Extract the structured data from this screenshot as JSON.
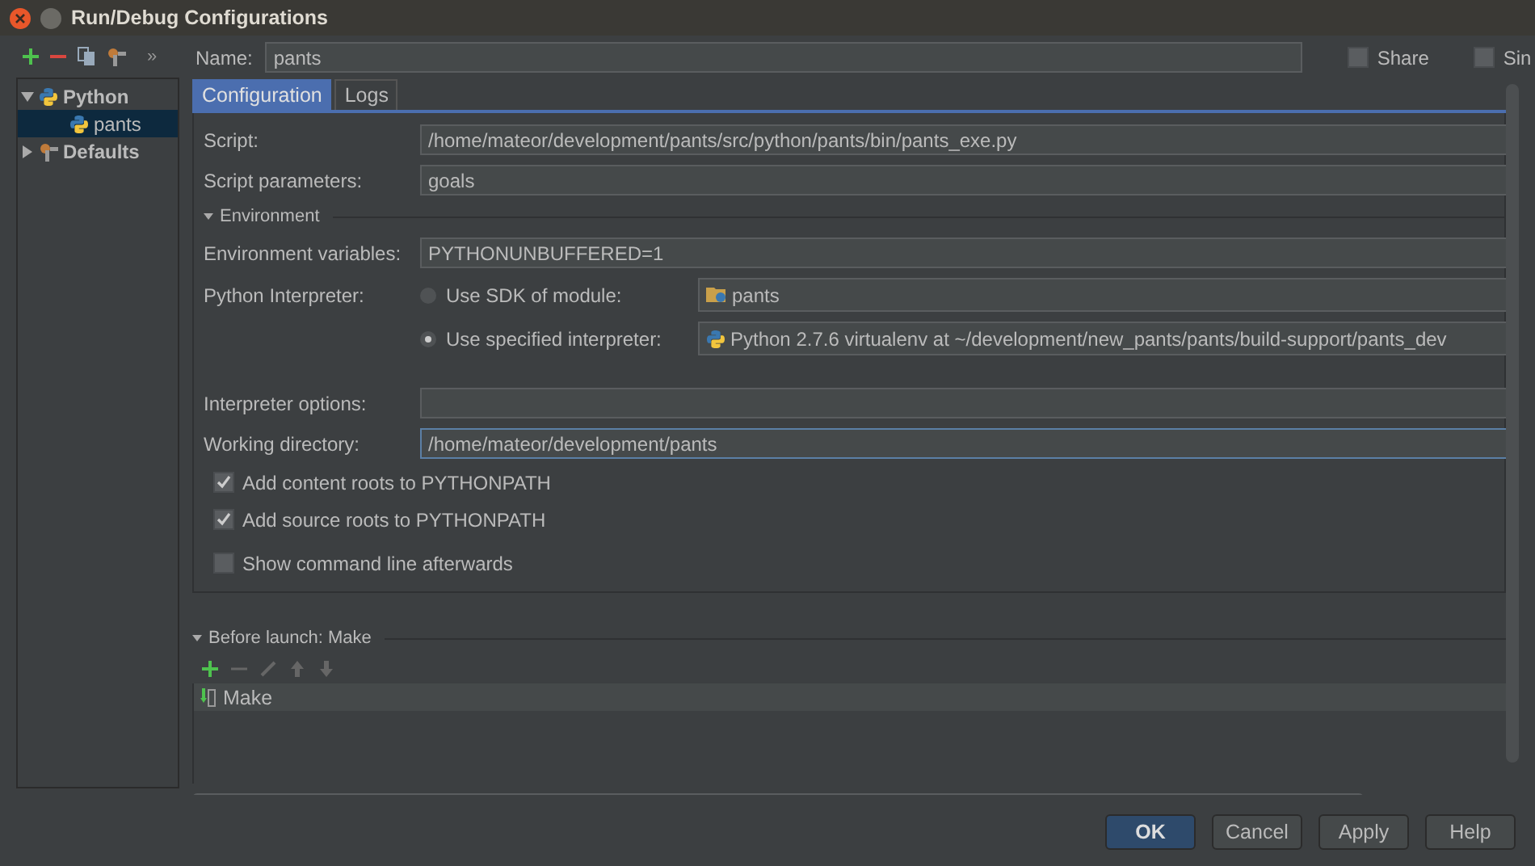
{
  "window": {
    "title": "Run/Debug Configurations"
  },
  "toolbar": {
    "more": "»"
  },
  "tree": [
    {
      "label": "Python",
      "kind": "python",
      "expanded": true,
      "selected": false,
      "children": [
        {
          "label": "pants",
          "kind": "python",
          "selected": true
        }
      ]
    },
    {
      "label": "Defaults",
      "kind": "defaults",
      "expanded": false,
      "selected": false
    }
  ],
  "name_field": {
    "label": "Name:",
    "value": "pants"
  },
  "header_checks": [
    {
      "label": "Share",
      "checked": false
    },
    {
      "label": "Sin",
      "checked": false
    }
  ],
  "tabs": [
    {
      "label": "Configuration",
      "selected": true
    },
    {
      "label": "Logs",
      "selected": false
    }
  ],
  "script": {
    "label": "Script:",
    "value": "/home/mateor/development/pants/src/python/pants/bin/pants_exe.py"
  },
  "script_parameters": {
    "label": "Script parameters:",
    "value": "goals"
  },
  "environment": {
    "title": "Environment",
    "expanded": true
  },
  "environment_variables": {
    "label": "Environment variables:",
    "value": "PYTHONUNBUFFERED=1"
  },
  "python_interpreter": {
    "label": "Python Interpreter:",
    "options": [
      {
        "label": "Use SDK of module:",
        "selected": false,
        "value": "pants",
        "kind": "module"
      },
      {
        "label": "Use specified interpreter:",
        "selected": true,
        "value": "Python 2.7.6 virtualenv at ~/development/new_pants/pants/build-support/pants_dev",
        "kind": "interpreter"
      }
    ]
  },
  "interpreter_options": {
    "label": "Interpreter options:"
  },
  "working_directory": {
    "label": "Working directory:",
    "value": "/home/mateor/development/pants",
    "focused": true
  },
  "checkboxes": [
    {
      "label": "Add content roots to PYTHONPATH",
      "checked": true
    },
    {
      "label": "Add source roots to PYTHONPATH",
      "checked": true
    },
    {
      "label": "Show command line afterwards",
      "checked": false
    }
  ],
  "before_launch": {
    "title": "Before launch: Make",
    "expanded": true,
    "items": [
      {
        "label": "Make"
      }
    ]
  },
  "buttons": [
    {
      "label": "OK",
      "kind": "default"
    },
    {
      "label": "Cancel",
      "kind": "normal"
    },
    {
      "label": "Apply",
      "kind": "normal"
    },
    {
      "label": "Help",
      "kind": "normal"
    }
  ]
}
